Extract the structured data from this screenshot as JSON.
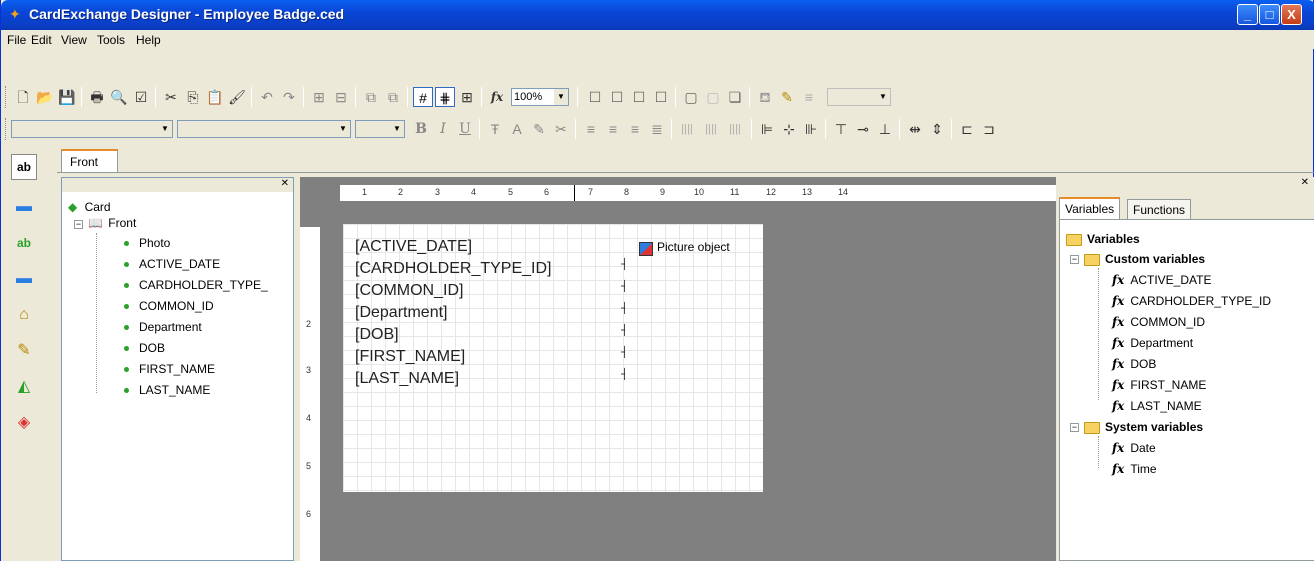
{
  "window": {
    "title": "CardExchange Designer - Employee Badge.ced",
    "controls": {
      "minimize": "_",
      "maximize": "□",
      "close": "X"
    }
  },
  "menu": [
    "File",
    "Edit",
    "View",
    "Tools",
    "Help"
  ],
  "toolbar1": {
    "zoom": "100%",
    "icons": [
      "new-icon",
      "open-icon",
      "save-icon",
      "print-icon",
      "print-preview-icon",
      "check-icon",
      "cut-icon",
      "copy-icon",
      "paste-icon",
      "format-painter-icon",
      "undo-icon",
      "redo-icon",
      "group-icon",
      "ungroup-icon",
      "bring-front-icon",
      "send-back-icon",
      "grid-icon",
      "snap-grid-icon",
      "table-icon",
      "function-icon"
    ]
  },
  "toolbar2": {
    "font_name": "",
    "font_style": "",
    "font_size": "",
    "bold": "B",
    "italic": "I",
    "underline": "U"
  },
  "toolbox": [
    "text-tool-icon",
    "image-tool-icon",
    "variable-text-tool-icon",
    "photo-tool-icon",
    "barcode-tool-icon",
    "pen-tool-icon",
    "shape-tool-icon",
    "color-tool-icon"
  ],
  "tabs": {
    "front": "Front"
  },
  "tree": {
    "root": "Card",
    "side": "Front",
    "items": [
      "Photo",
      "ACTIVE_DATE",
      "CARDHOLDER_TYPE_",
      "COMMON_ID",
      "Department",
      "DOB",
      "FIRST_NAME",
      "LAST_NAME"
    ]
  },
  "ruler": {
    "h_labels": [
      "1",
      "2",
      "3",
      "4",
      "5",
      "6",
      "7",
      "8",
      "9",
      "10",
      "11",
      "12",
      "13",
      "14"
    ],
    "v_labels": [
      "2",
      "3",
      "4",
      "5",
      "6"
    ]
  },
  "card": {
    "fields": [
      "[ACTIVE_DATE]",
      "[CARDHOLDER_TYPE_ID]",
      "[COMMON_ID]",
      "[Department]",
      "[DOB]",
      "[FIRST_NAME]",
      "[LAST_NAME]"
    ],
    "picture_label": "Picture object"
  },
  "right_panel": {
    "tabs": [
      "Variables",
      "Functions"
    ],
    "root": "Variables",
    "custom_label": "Custom variables",
    "custom": [
      "ACTIVE_DATE",
      "CARDHOLDER_TYPE_ID",
      "COMMON_ID",
      "Department",
      "DOB",
      "FIRST_NAME",
      "LAST_NAME"
    ],
    "system_label": "System variables",
    "system": [
      "Date",
      "Time"
    ]
  }
}
